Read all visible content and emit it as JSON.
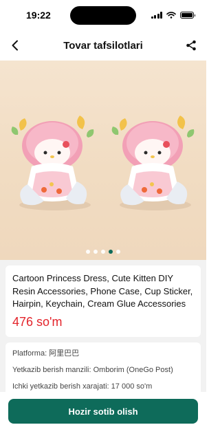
{
  "status_bar": {
    "time": "19:22"
  },
  "header": {
    "title": "Tovar tafsilotlari",
    "back_icon": "chevron-left-icon",
    "share_icon": "share-icon"
  },
  "gallery": {
    "slide_count": 5,
    "active_slide": 4
  },
  "product": {
    "title": "Cartoon Princess Dress, Cute Kitten DIY Resin Accessories, Phone Case, Cup Sticker, Hairpin, Keychain, Cream Glue Accessories",
    "price": "476 so'm"
  },
  "details": [
    {
      "label": "Platforma: 阿里巴巴"
    },
    {
      "label": "Yetkazib berish manzili: Omborim (OneGo Post)"
    },
    {
      "label": "Ichki yetkazib berish xarajati: 17 000 so'm"
    }
  ],
  "actions": {
    "buy_now": "Hozir sotib olish"
  },
  "colors": {
    "accent": "#0e6b5a",
    "price": "#e3242b"
  }
}
